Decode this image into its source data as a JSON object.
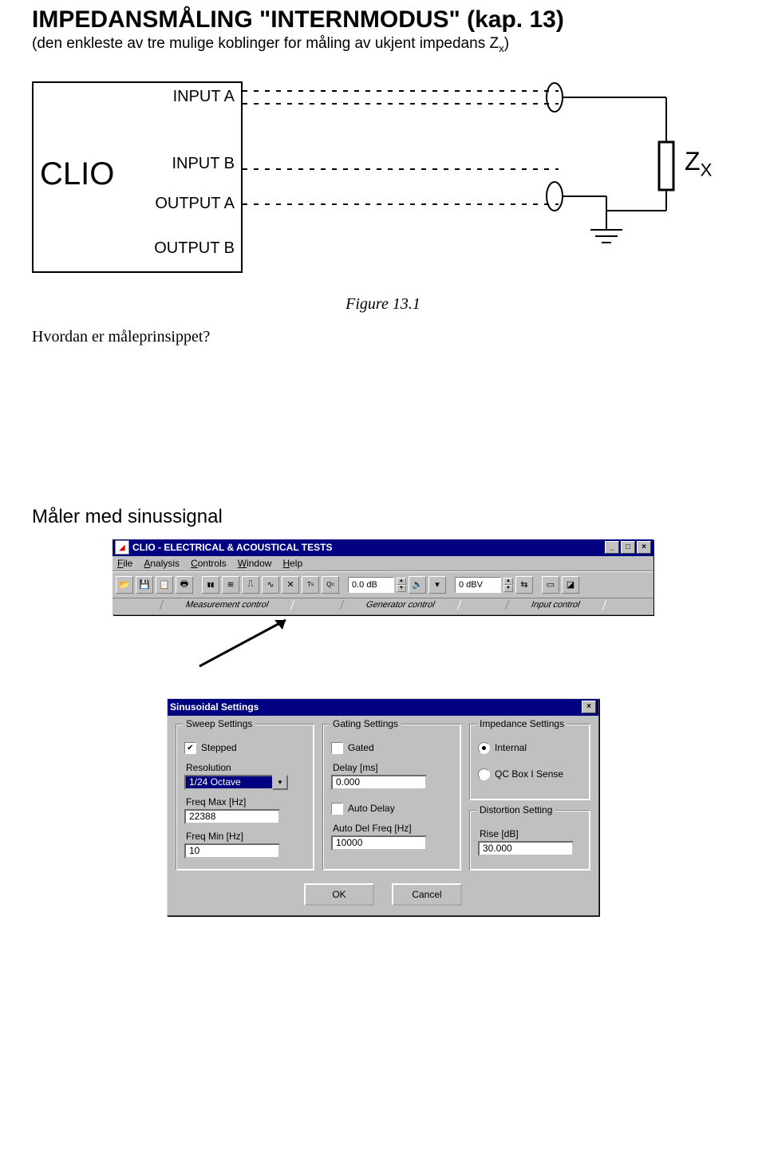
{
  "title": "IMPEDANSMÅLING \"INTERNMODUS\"  (kap. 13)",
  "subtitle": "(den enkleste av tre mulige koblinger for måling av ukjent impedans Z",
  "subtitle_sub": "x",
  "subtitle_tail": ")",
  "diagram": {
    "box": "CLIO",
    "ports": [
      "INPUT A",
      "INPUT B",
      "OUTPUT A",
      "OUTPUT B"
    ],
    "load": "Z",
    "load_sub": "X"
  },
  "figure_caption": "Figure 13.1",
  "question": "Hvordan er måleprinsippet?",
  "section2": "Måler med sinussignal",
  "app": {
    "title": "CLIO - ELECTRICAL & ACOUSTICAL TESTS",
    "menu": [
      "File",
      "Analysis",
      "Controls",
      "Window",
      "Help"
    ],
    "db_field": "0.0 dB",
    "dbv_field": "0 dBV",
    "ctrl_labels": [
      "Measurement control",
      "Generator control",
      "Input control"
    ]
  },
  "dialog": {
    "title": "Sinusoidal Settings",
    "sweep": {
      "title": "Sweep Settings",
      "stepped": "Stepped",
      "resolution_label": "Resolution",
      "resolution_value": "1/24 Octave",
      "fmax_label": "Freq Max [Hz]",
      "fmax_value": "22388",
      "fmin_label": "Freq Min [Hz]",
      "fmin_value": "10"
    },
    "gating": {
      "title": "Gating Settings",
      "gated": "Gated",
      "delay_label": "Delay [ms]",
      "delay_value": "0.000",
      "auto_delay": "Auto Delay",
      "adf_label": "Auto Del Freq [Hz]",
      "adf_value": "10000"
    },
    "impedance": {
      "title": "Impedance Settings",
      "internal": "Internal",
      "qcbox": "QC Box I Sense"
    },
    "distortion": {
      "title": "Distortion Setting",
      "rise_label": "Rise [dB]",
      "rise_value": "30.000"
    },
    "ok": "OK",
    "cancel": "Cancel"
  }
}
